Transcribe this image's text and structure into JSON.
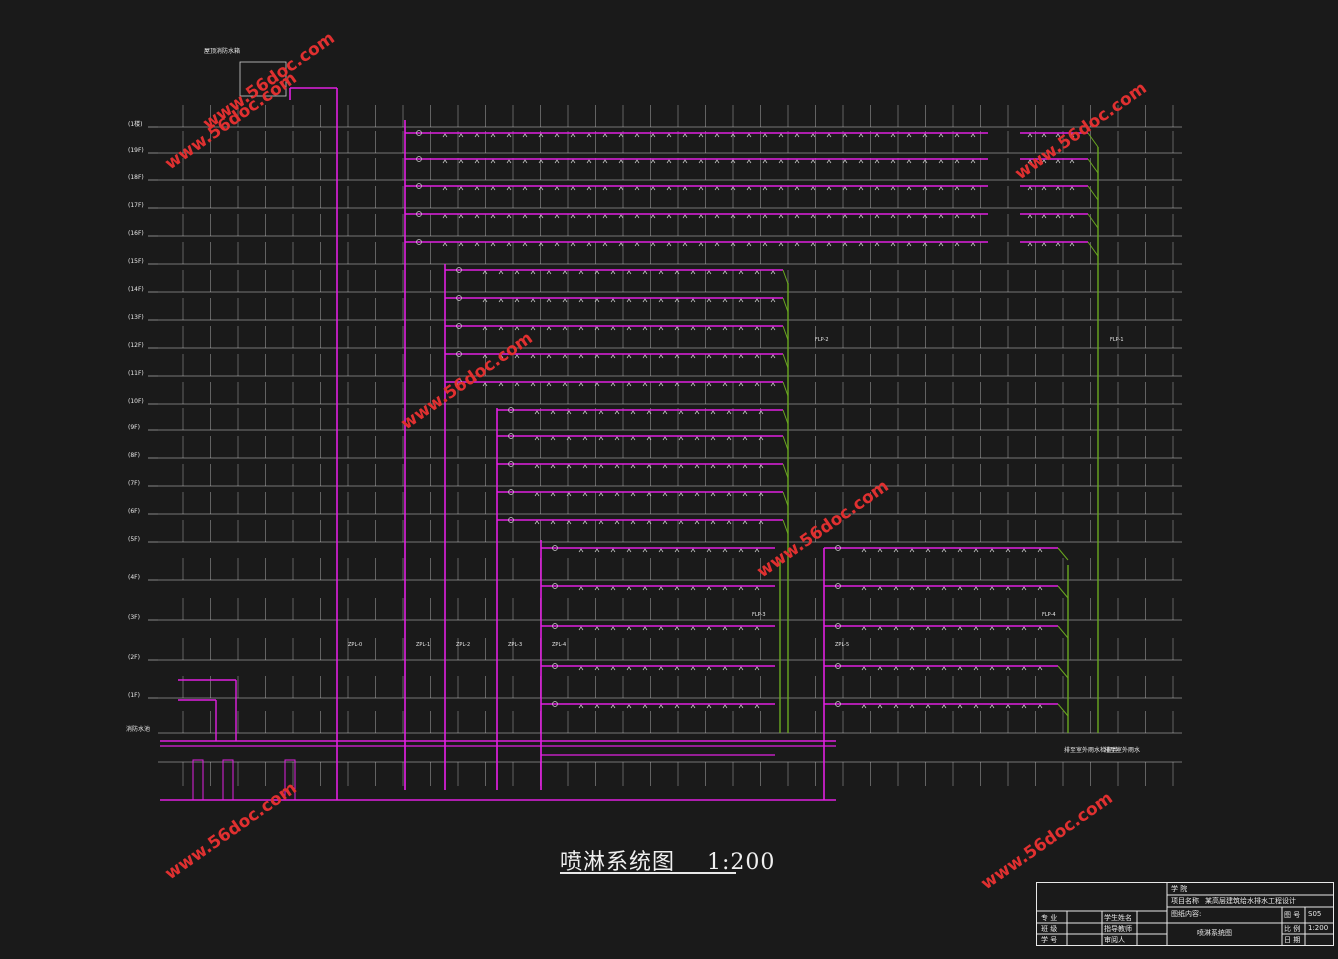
{
  "drawing": {
    "caption": "喷淋系统图",
    "scale": "1:200"
  },
  "floors": [
    "(1楼)",
    "(19F)",
    "(18F)",
    "(17F)",
    "(16F)",
    "(15F)",
    "(14F)",
    "(13F)",
    "(12F)",
    "(11F)",
    "(10F)",
    "(9F)",
    "(8F)",
    "(7F)",
    "(6F)",
    "(5F)",
    "(4F)",
    "(3F)",
    "(2F)",
    "(1F)"
  ],
  "risers": [
    "ZPL-0",
    "ZPL-1",
    "ZPL-2",
    "ZPL-3",
    "ZPL-4",
    "ZPL-5"
  ],
  "drains": [
    "FLP-1",
    "FLP-2",
    "FLP-3",
    "FLP-4"
  ],
  "notes": {
    "top_tank": "屋顶消防水箱",
    "bottom_left": "消防水池",
    "outlet_1": "排至室外雨水检查井",
    "outlet_2": "排至室外雨水"
  },
  "watermark": "www.56doc.com",
  "title_block": {
    "school": "学 院",
    "project_label": "项目名称",
    "project": "某高层建筑给水排水工程设计",
    "content_label": "图纸内容:",
    "content": "喷淋系统图",
    "row_major": "专 业",
    "row_class": "班 级",
    "row_id": "学 号",
    "student": "学生姓名",
    "teacher": "指导教师",
    "reviewer": "审阅人",
    "drawing_no_label": "图 号",
    "drawing_no": "S05",
    "scale_label": "比 例",
    "scale": "1:200",
    "date_label": "日 期"
  },
  "colors": {
    "background": "#1a1a1a",
    "pipe": "#e020e0",
    "drain": "#6aa820",
    "grid": "#cfcfcf",
    "text": "#e8e8e8",
    "watermark": "#e03030"
  }
}
